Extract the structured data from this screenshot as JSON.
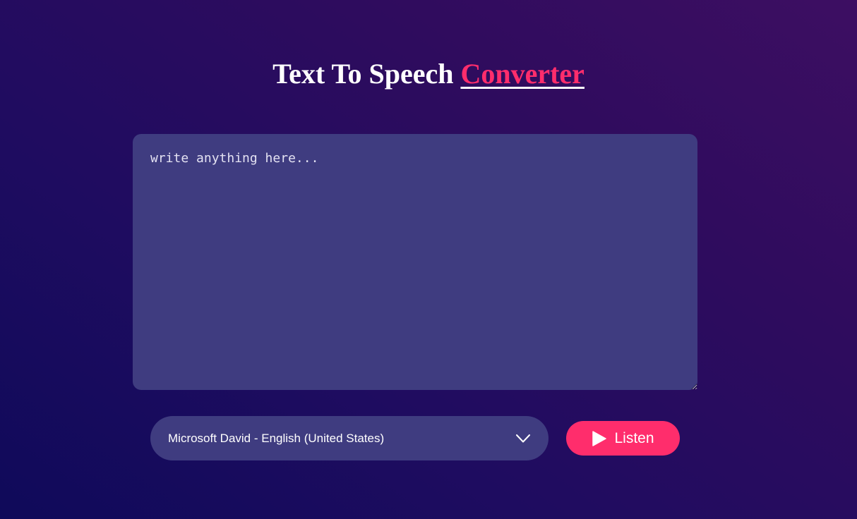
{
  "header": {
    "title_main": "Text To Speech ",
    "title_accent": "Converter"
  },
  "editor": {
    "placeholder": "write anything here...",
    "value": ""
  },
  "voice_select": {
    "selected": "Microsoft David - English (United States)",
    "icon": "chevron-down-icon"
  },
  "listen_button": {
    "label": "Listen",
    "icon": "play-icon"
  },
  "colors": {
    "accent": "#ff2d6c",
    "panel": "#3f3c80",
    "background_start": "#0f0a5a",
    "background_end": "#3d0e62"
  }
}
